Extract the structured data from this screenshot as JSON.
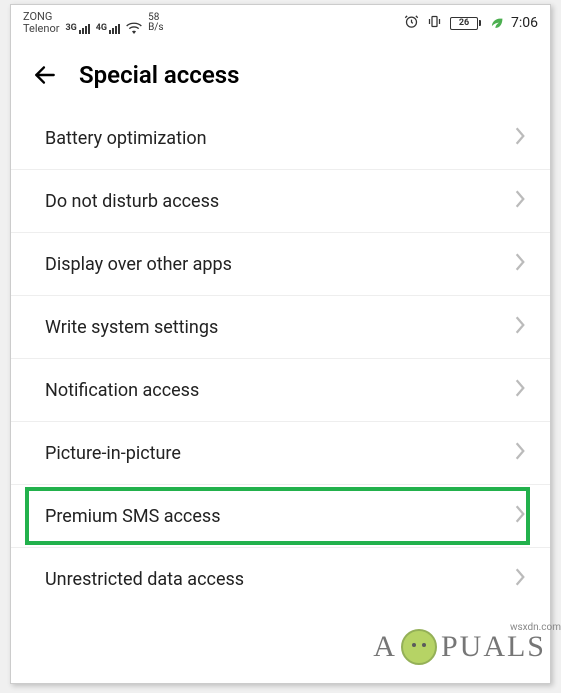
{
  "status_bar": {
    "carrier1": "ZONG",
    "carrier2": "Telenor",
    "net1": "3G",
    "net2": "4G",
    "speed_value": "58",
    "speed_unit": "B/s",
    "battery_pct": "26",
    "time": "7:06"
  },
  "header": {
    "title": "Special access"
  },
  "items": [
    {
      "label": "Battery optimization",
      "highlighted": false
    },
    {
      "label": "Do not disturb access",
      "highlighted": false
    },
    {
      "label": "Display over other apps",
      "highlighted": false
    },
    {
      "label": "Write system settings",
      "highlighted": false
    },
    {
      "label": "Notification access",
      "highlighted": false
    },
    {
      "label": "Picture-in-picture",
      "highlighted": false
    },
    {
      "label": "Premium SMS access",
      "highlighted": true
    },
    {
      "label": "Unrestricted data access",
      "highlighted": false
    }
  ],
  "watermark": {
    "prefix": "A",
    "suffix": "PUALS",
    "side": "wsxdn.com"
  }
}
